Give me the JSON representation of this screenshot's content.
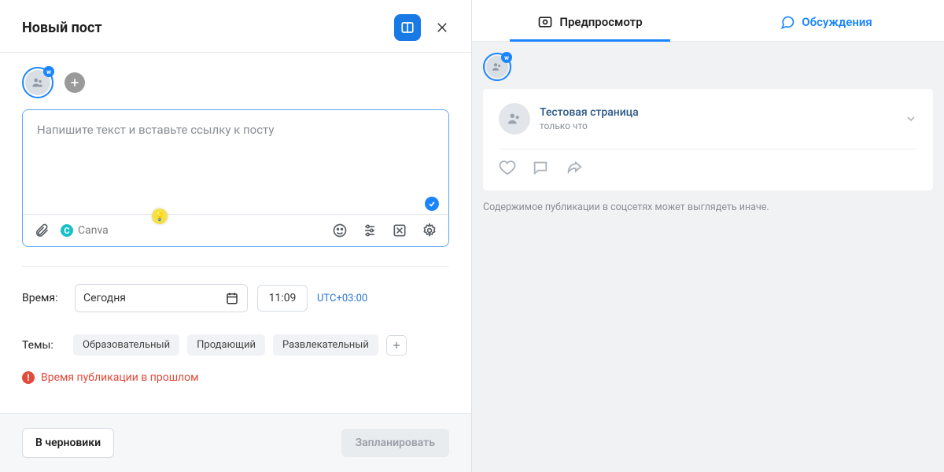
{
  "header": {
    "title": "Новый пост"
  },
  "compose": {
    "placeholder": "Напишите текст и вставьте ссылку к посту",
    "canva_label": "Canva"
  },
  "schedule": {
    "label": "Время:",
    "date_value": "Сегодня",
    "time_value": "11:09",
    "timezone": "UTC+03:00"
  },
  "themes": {
    "label": "Темы:",
    "items": [
      "Образовательный",
      "Продающий",
      "Развлекательный"
    ]
  },
  "error": {
    "text": "Время публикации в прошлом"
  },
  "footer": {
    "draft_label": "В черновики",
    "schedule_label": "Запланировать"
  },
  "tabs": {
    "preview": "Предпросмотр",
    "discuss": "Обсуждения"
  },
  "preview": {
    "page_name": "Тестовая страница",
    "time_text": "только что",
    "note": "Содержимое публикации в соцсетях может выглядеть иначе."
  },
  "icons": {
    "vk": "w"
  }
}
